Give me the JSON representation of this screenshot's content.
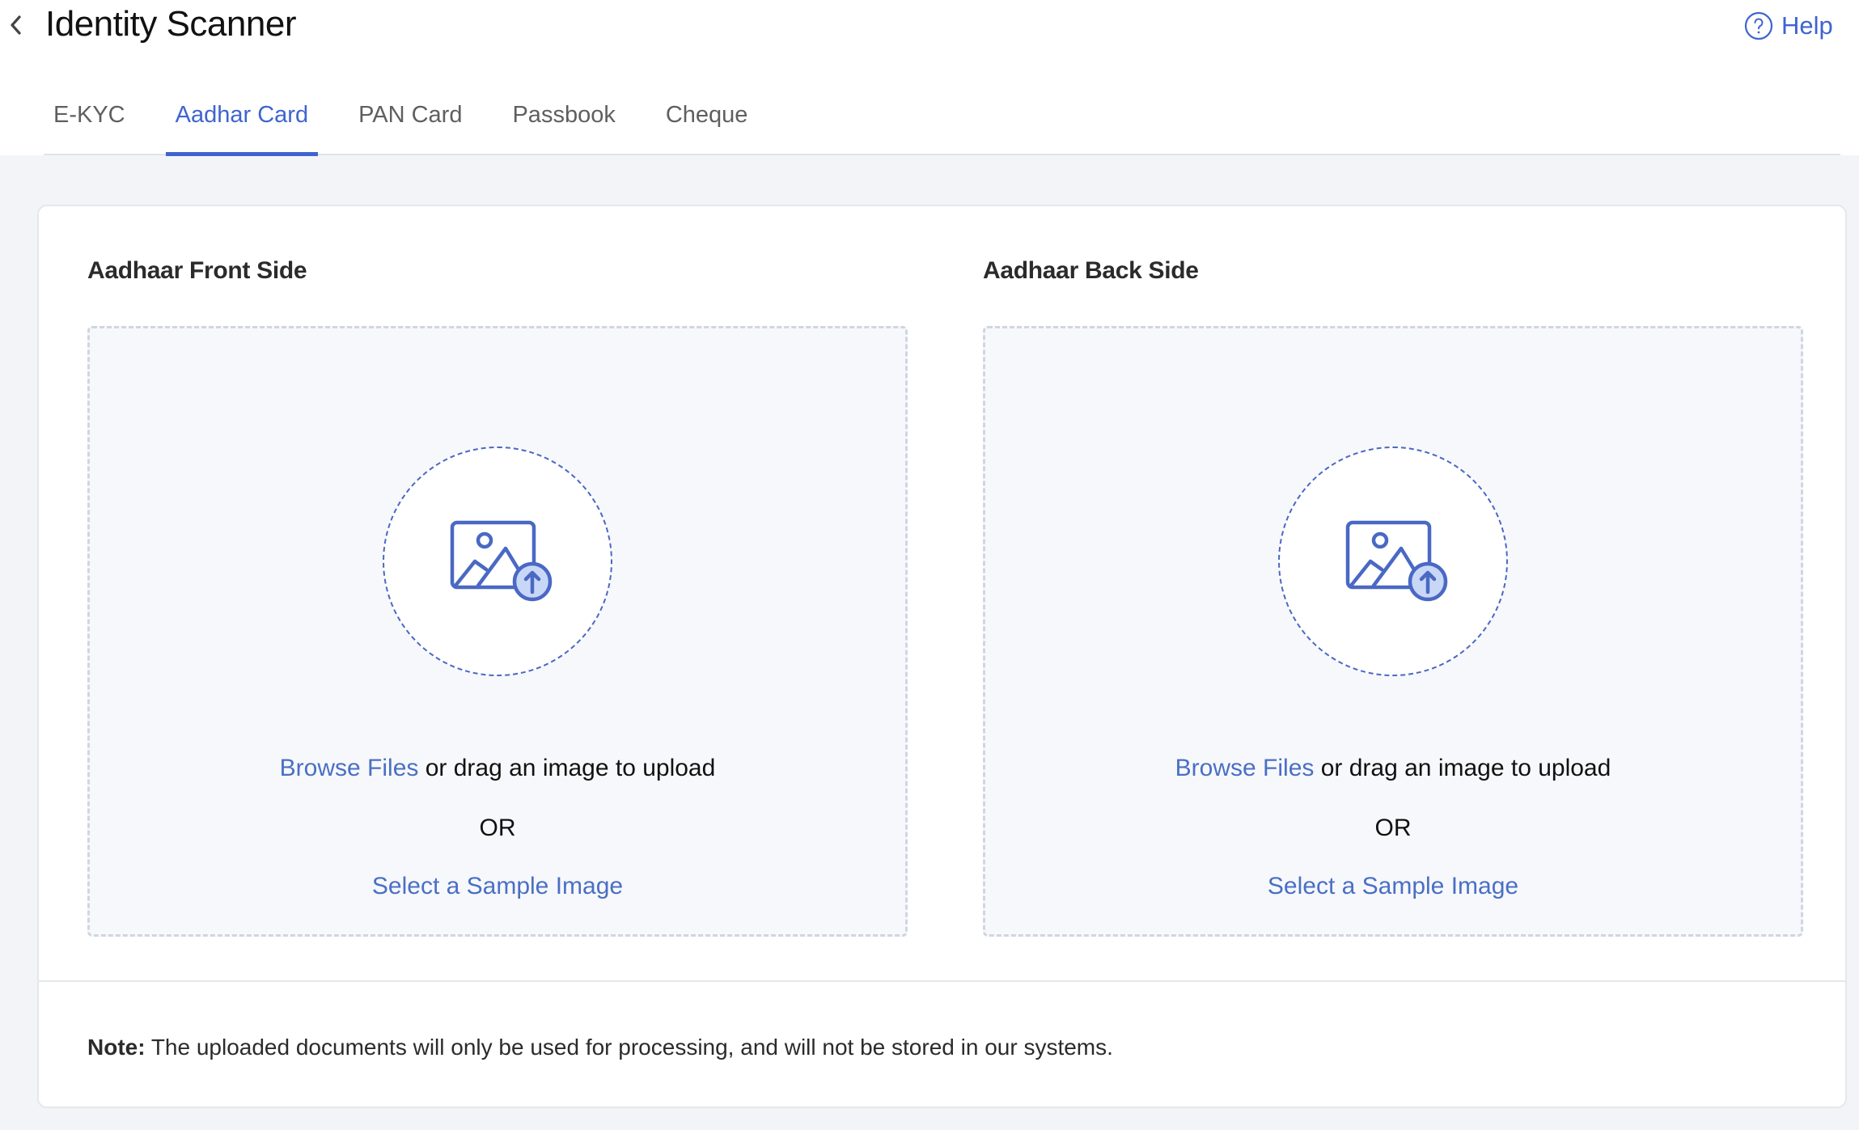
{
  "header": {
    "title": "Identity Scanner",
    "back_icon": "chevron-left-icon",
    "help_label": "Help",
    "help_icon": "question-circle-icon"
  },
  "tabs": [
    {
      "label": "E-KYC",
      "active": false
    },
    {
      "label": "Aadhar Card",
      "active": true
    },
    {
      "label": "PAN Card",
      "active": false
    },
    {
      "label": "Passbook",
      "active": false
    },
    {
      "label": "Cheque",
      "active": false
    }
  ],
  "upload": {
    "front": {
      "heading": "Aadhaar Front Side",
      "icon": "image-upload-icon",
      "browse_label": "Browse Files",
      "drag_text": " or drag an image to upload",
      "or_text": "OR",
      "sample_label": "Select a Sample Image"
    },
    "back": {
      "heading": "Aadhaar Back Side",
      "icon": "image-upload-icon",
      "browse_label": "Browse Files",
      "drag_text": " or drag an image to upload",
      "or_text": "OR",
      "sample_label": "Select a Sample Image"
    }
  },
  "note": {
    "label": "Note:",
    "text": " The uploaded documents will only be used for processing, and will not be stored in our systems."
  },
  "colors": {
    "accent": "#3f64d0",
    "link": "#4a6fc5",
    "background": "#f3f4f7",
    "dropzone_bg": "#f7f8fb"
  }
}
